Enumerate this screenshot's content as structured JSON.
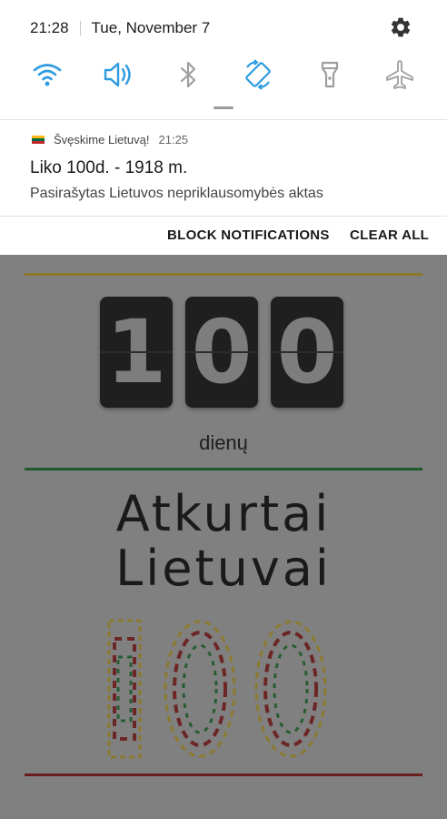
{
  "status": {
    "time": "21:28",
    "date": "Tue, November 7",
    "settings_icon": "gear-icon"
  },
  "quick_settings": [
    {
      "name": "wifi-icon",
      "state": "on",
      "color": "#2e9be0"
    },
    {
      "name": "sound-icon",
      "state": "on",
      "color": "#2e9be0"
    },
    {
      "name": "bluetooth-icon",
      "state": "off",
      "color": "#9e9e9e"
    },
    {
      "name": "auto-rotate-icon",
      "state": "on",
      "color": "#2e9be0"
    },
    {
      "name": "flashlight-icon",
      "state": "off",
      "color": "#9e9e9e"
    },
    {
      "name": "airplane-mode-icon",
      "state": "off",
      "color": "#9e9e9e"
    }
  ],
  "notification": {
    "app_name": "Švęskime Lietuvą!",
    "time": "21:25",
    "title": "Liko 100d. - 1918 m.",
    "text": "Pasirašytas Lietuvos nepriklausomybės aktas"
  },
  "actions": {
    "block": "BLOCK NOTIFICATIONS",
    "clear": "CLEAR ALL"
  },
  "app": {
    "digits": [
      "1",
      "0",
      "0"
    ],
    "days_label": "dienų",
    "brand_line1": "Atkurtai",
    "brand_line2": "Lietuvai",
    "colors": {
      "yellow": "#8c7a2a",
      "green": "#1f5a2a",
      "red": "#6a1d1d"
    }
  }
}
